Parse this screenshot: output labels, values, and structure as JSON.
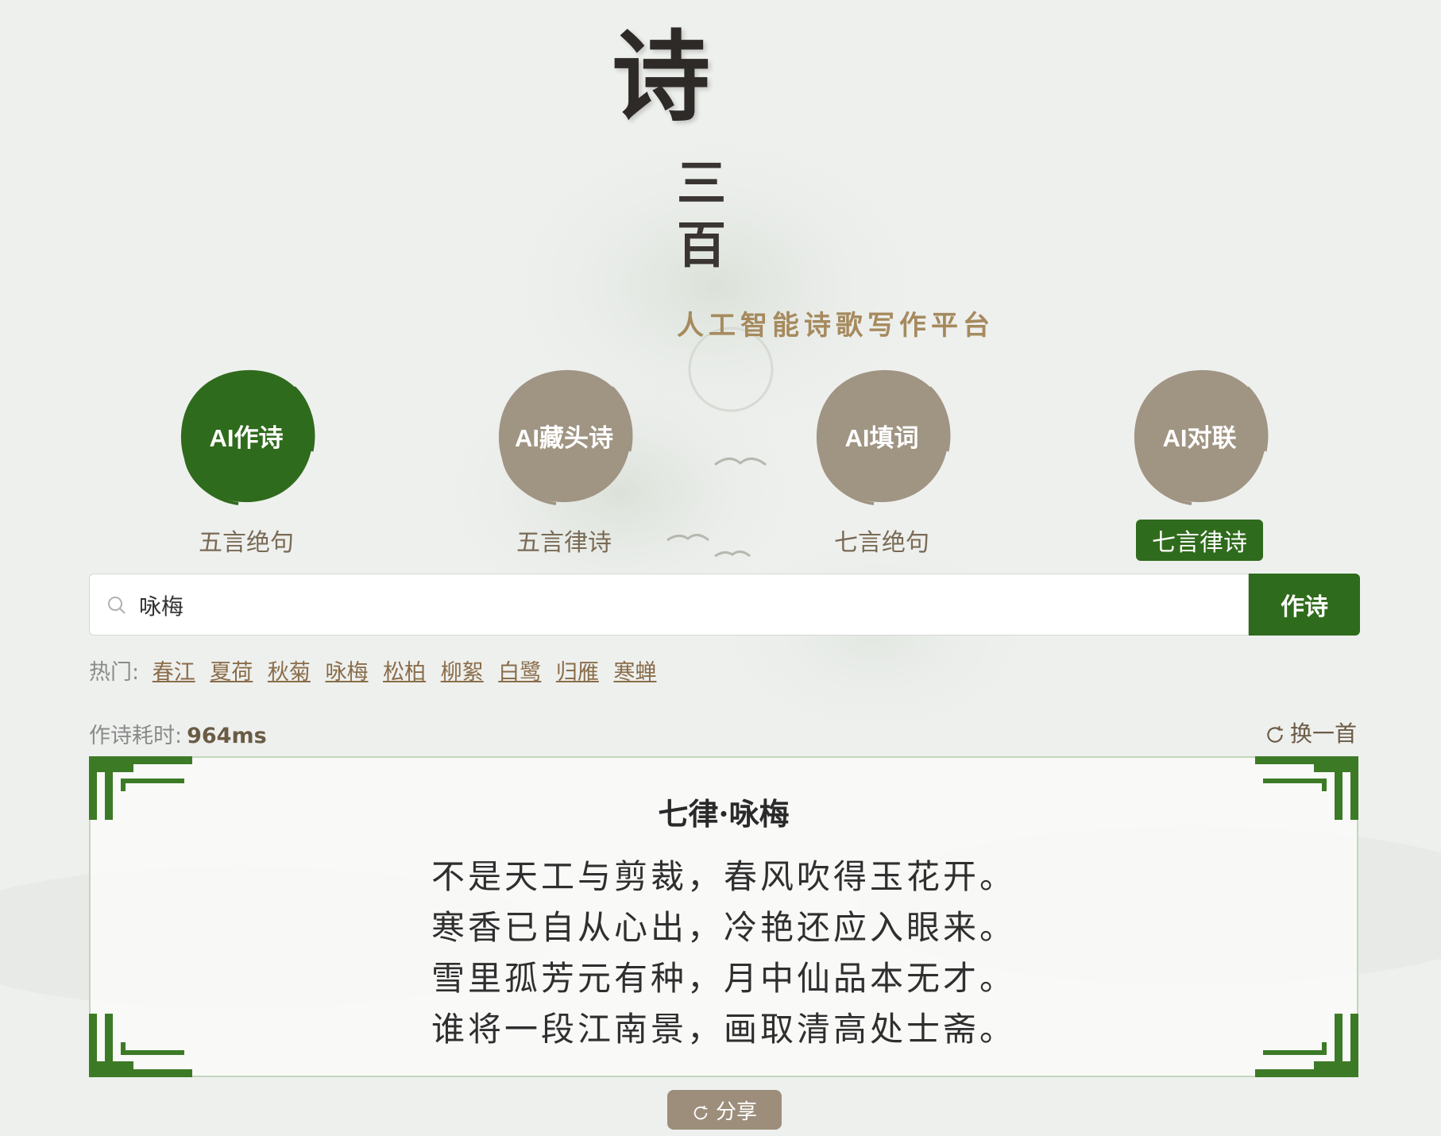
{
  "brand": {
    "logo_main": "诗",
    "logo_sub_1": "三",
    "logo_sub_2": "百",
    "tagline": "人工智能诗歌写作平台"
  },
  "modes": [
    {
      "label": "AI作诗",
      "type": "五言绝句",
      "active": true
    },
    {
      "label": "AI藏头诗",
      "type": "五言律诗",
      "active": false
    },
    {
      "label": "AI填词",
      "type": "七言绝句",
      "active": false
    },
    {
      "label": "AI对联",
      "type": "七言律诗",
      "active": true
    }
  ],
  "search": {
    "value": "咏梅",
    "button": "作诗"
  },
  "hot": {
    "prefix": "热门:",
    "topics": [
      "春江",
      "夏荷",
      "秋菊",
      "咏梅",
      "松柏",
      "柳絮",
      "白鹭",
      "归雁",
      "寒蝉"
    ]
  },
  "result": {
    "elapsed_label": "作诗耗时:",
    "elapsed_value": "964ms",
    "refresh_label": "换一首",
    "title": "七律·咏梅",
    "lines": [
      "不是天工与剪裁，春风吹得玉花开。",
      "寒香已自从心出，冷艳还应入眼来。",
      "雪里孤芳元有种，月中仙品本无才。",
      "谁将一段江南景，画取清高处士斋。"
    ],
    "share_label": "分享"
  },
  "colors": {
    "accent": "#2f6b1c",
    "ink_inactive": "#a09483",
    "gold": "#a68a5e"
  }
}
